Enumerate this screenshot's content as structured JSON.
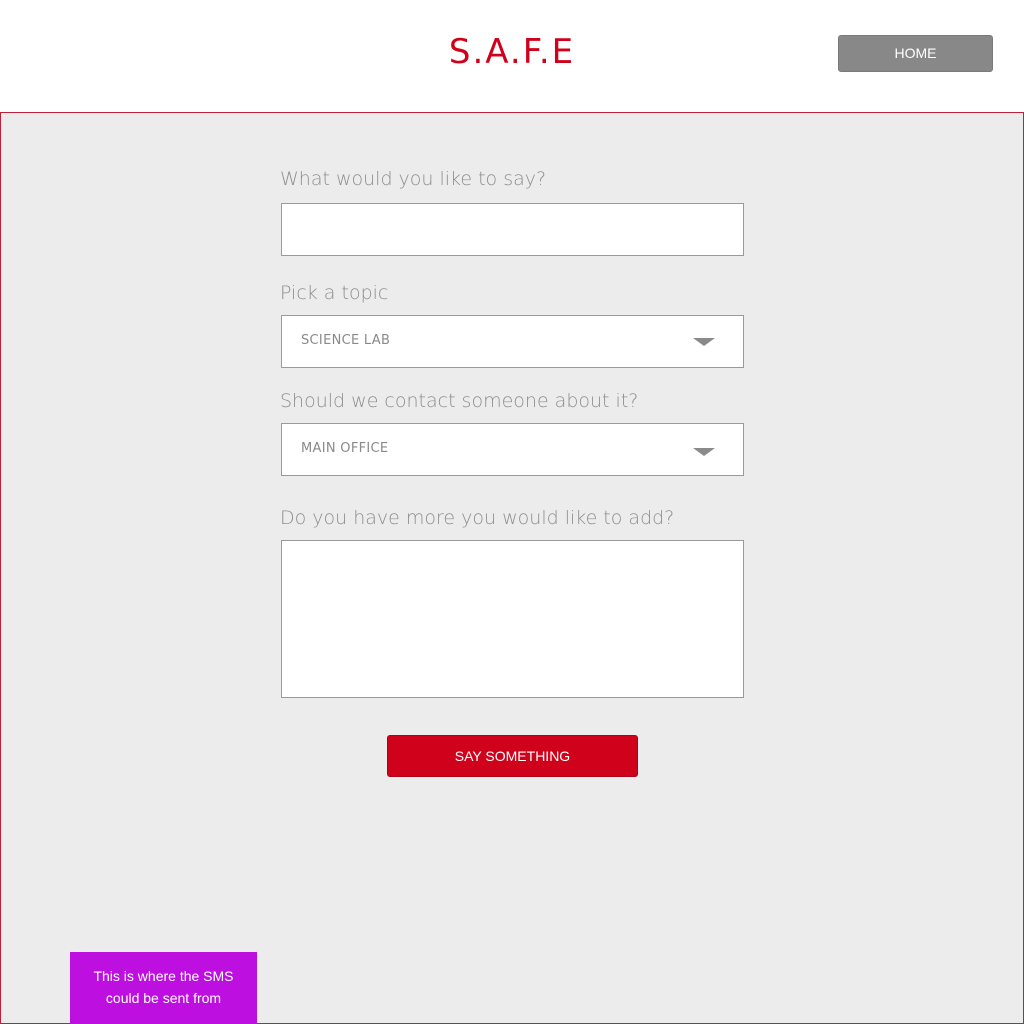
{
  "header": {
    "logo_text": "S.A.F.E",
    "home_label": "HOME"
  },
  "form": {
    "message_label": "What would you like to say?",
    "message_value": "",
    "topic_label": "Pick a topic",
    "topic_value": "SCIENCE LAB",
    "contact_label": "Should we contact someone about it?",
    "contact_value": "MAIN OFFICE",
    "more_label": "Do you have more you would like to add?",
    "more_value": "",
    "submit_label": "SAY SOMETHING"
  },
  "annotation": {
    "sms_note": "This is where the SMS could be sent from"
  },
  "colors": {
    "brand": "#d0021b",
    "home_button": "#888888",
    "note": "#bd10e0",
    "background": "#ececec"
  }
}
